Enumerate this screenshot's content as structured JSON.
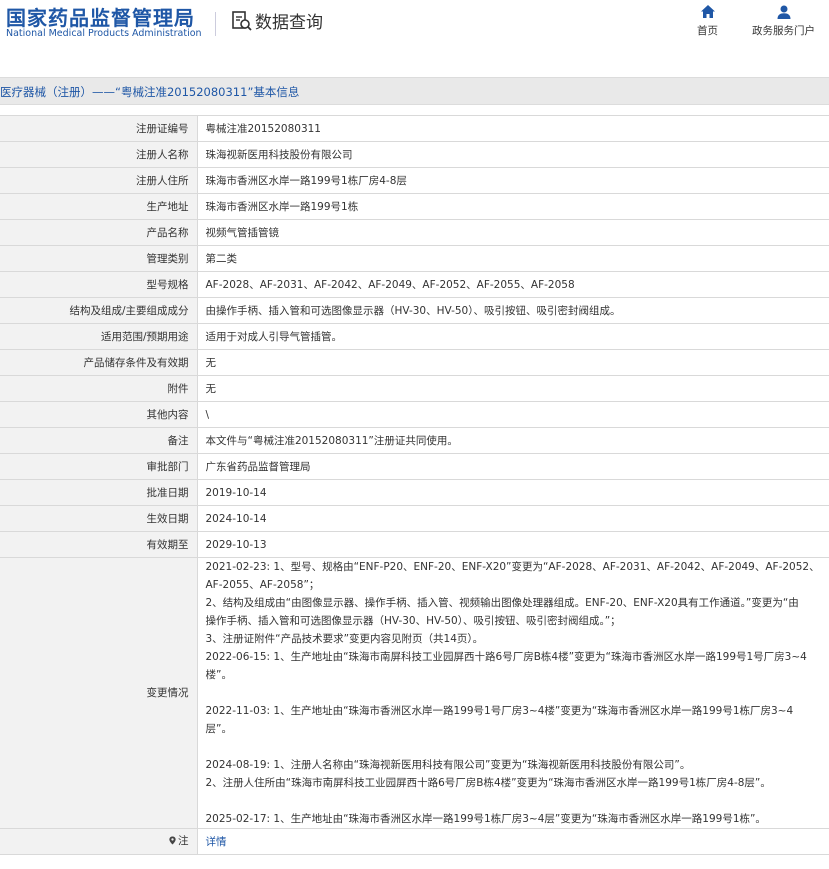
{
  "header": {
    "logo_cn": "国家药品监督管理局",
    "logo_en": "National Medical Products Administration",
    "query_title": "数据查询",
    "nav": {
      "home": "首页",
      "portal": "政务服务门户"
    }
  },
  "banner": {
    "title": "医疗器械（注册）——“粤械注准20152080311”基本信息"
  },
  "rows": [
    {
      "label": "注册证编号",
      "value": "粤械注准20152080311"
    },
    {
      "label": "注册人名称",
      "value": "珠海视新医用科技股份有限公司"
    },
    {
      "label": "注册人住所",
      "value": "珠海市香洲区水岸一路199号1栋厂房4-8层"
    },
    {
      "label": "生产地址",
      "value": "珠海市香洲区水岸一路199号1栋"
    },
    {
      "label": "产品名称",
      "value": "视频气管插管镜"
    },
    {
      "label": "管理类别",
      "value": "第二类"
    },
    {
      "label": "型号规格",
      "value": "AF-2028、AF-2031、AF-2042、AF-2049、AF-2052、AF-2055、AF-2058"
    },
    {
      "label": "结构及组成/主要组成成分",
      "value": "由操作手柄、插入管和可选图像显示器（HV-30、HV-50）、吸引按钮、吸引密封阀组成。"
    },
    {
      "label": "适用范围/预期用途",
      "value": "适用于对成人引导气管插管。"
    },
    {
      "label": "产品储存条件及有效期",
      "value": "无"
    },
    {
      "label": "附件",
      "value": "无"
    },
    {
      "label": "其他内容",
      "value": "\\"
    },
    {
      "label": "备注",
      "value": "本文件与“粤械注准20152080311”注册证共同使用。"
    },
    {
      "label": "审批部门",
      "value": "广东省药品监督管理局"
    },
    {
      "label": "批准日期",
      "value": "2019-10-14"
    },
    {
      "label": "生效日期",
      "value": "2024-10-14"
    },
    {
      "label": "有效期至",
      "value": "2029-10-13"
    }
  ],
  "changes": {
    "label": "变更情况",
    "blocks": [
      [
        "2021-02-23: 1、型号、规格由“ENF-P20、ENF-20、ENF-X20”变更为“AF-2028、AF-2031、AF-2042、AF-2049、AF-2052、",
        "AF-2055、AF-2058”；",
        "2、结构及组成由“由图像显示器、操作手柄、插入管、视频输出图像处理器组成。ENF-20、ENF-X20具有工作通道。”变更为“由",
        "操作手柄、插入管和可选图像显示器（HV-30、HV-50）、吸引按钮、吸引密封阀组成。”；",
        "3、注册证附件“产品技术要求”变更内容见附页（共14页）。",
        "2022-06-15: 1、生产地址由“珠海市南屏科技工业园屏西十路6号厂房B栋4楼”变更为“珠海市香洲区水岸一路199号1号厂房3~4",
        "楼”。"
      ],
      [
        "2022-11-03: 1、生产地址由“珠海市香洲区水岸一路199号1号厂房3~4楼”变更为“珠海市香洲区水岸一路199号1栋厂房3~4",
        "层”。"
      ],
      [
        "2024-08-19: 1、注册人名称由“珠海视新医用科技有限公司”变更为“珠海视新医用科技股份有限公司”。",
        "2、注册人住所由“珠海市南屏科技工业园屏西十路6号厂房B栋4楼”变更为“珠海市香洲区水岸一路199号1栋厂房4-8层”。"
      ],
      [
        "2025-02-17: 1、生产地址由“珠海市香洲区水岸一路199号1栋厂房3~4层”变更为“珠海市香洲区水岸一路199号1栋”。"
      ]
    ]
  },
  "note": {
    "label": "注",
    "link": "详情"
  }
}
